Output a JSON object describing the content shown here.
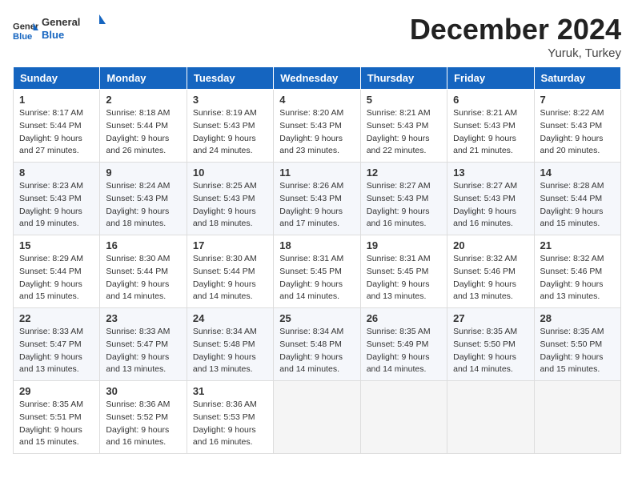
{
  "header": {
    "logo_line1": "General",
    "logo_line2": "Blue",
    "month_title": "December 2024",
    "location": "Yuruk, Turkey"
  },
  "weekdays": [
    "Sunday",
    "Monday",
    "Tuesday",
    "Wednesday",
    "Thursday",
    "Friday",
    "Saturday"
  ],
  "weeks": [
    [
      {
        "day": 1,
        "sunrise": "8:17 AM",
        "sunset": "5:44 PM",
        "daylight": "9 hours and 27 minutes."
      },
      {
        "day": 2,
        "sunrise": "8:18 AM",
        "sunset": "5:44 PM",
        "daylight": "9 hours and 26 minutes."
      },
      {
        "day": 3,
        "sunrise": "8:19 AM",
        "sunset": "5:43 PM",
        "daylight": "9 hours and 24 minutes."
      },
      {
        "day": 4,
        "sunrise": "8:20 AM",
        "sunset": "5:43 PM",
        "daylight": "9 hours and 23 minutes."
      },
      {
        "day": 5,
        "sunrise": "8:21 AM",
        "sunset": "5:43 PM",
        "daylight": "9 hours and 22 minutes."
      },
      {
        "day": 6,
        "sunrise": "8:21 AM",
        "sunset": "5:43 PM",
        "daylight": "9 hours and 21 minutes."
      },
      {
        "day": 7,
        "sunrise": "8:22 AM",
        "sunset": "5:43 PM",
        "daylight": "9 hours and 20 minutes."
      }
    ],
    [
      {
        "day": 8,
        "sunrise": "8:23 AM",
        "sunset": "5:43 PM",
        "daylight": "9 hours and 19 minutes."
      },
      {
        "day": 9,
        "sunrise": "8:24 AM",
        "sunset": "5:43 PM",
        "daylight": "9 hours and 18 minutes."
      },
      {
        "day": 10,
        "sunrise": "8:25 AM",
        "sunset": "5:43 PM",
        "daylight": "9 hours and 18 minutes."
      },
      {
        "day": 11,
        "sunrise": "8:26 AM",
        "sunset": "5:43 PM",
        "daylight": "9 hours and 17 minutes."
      },
      {
        "day": 12,
        "sunrise": "8:27 AM",
        "sunset": "5:43 PM",
        "daylight": "9 hours and 16 minutes."
      },
      {
        "day": 13,
        "sunrise": "8:27 AM",
        "sunset": "5:43 PM",
        "daylight": "9 hours and 16 minutes."
      },
      {
        "day": 14,
        "sunrise": "8:28 AM",
        "sunset": "5:44 PM",
        "daylight": "9 hours and 15 minutes."
      }
    ],
    [
      {
        "day": 15,
        "sunrise": "8:29 AM",
        "sunset": "5:44 PM",
        "daylight": "9 hours and 15 minutes."
      },
      {
        "day": 16,
        "sunrise": "8:30 AM",
        "sunset": "5:44 PM",
        "daylight": "9 hours and 14 minutes."
      },
      {
        "day": 17,
        "sunrise": "8:30 AM",
        "sunset": "5:44 PM",
        "daylight": "9 hours and 14 minutes."
      },
      {
        "day": 18,
        "sunrise": "8:31 AM",
        "sunset": "5:45 PM",
        "daylight": "9 hours and 14 minutes."
      },
      {
        "day": 19,
        "sunrise": "8:31 AM",
        "sunset": "5:45 PM",
        "daylight": "9 hours and 13 minutes."
      },
      {
        "day": 20,
        "sunrise": "8:32 AM",
        "sunset": "5:46 PM",
        "daylight": "9 hours and 13 minutes."
      },
      {
        "day": 21,
        "sunrise": "8:32 AM",
        "sunset": "5:46 PM",
        "daylight": "9 hours and 13 minutes."
      }
    ],
    [
      {
        "day": 22,
        "sunrise": "8:33 AM",
        "sunset": "5:47 PM",
        "daylight": "9 hours and 13 minutes."
      },
      {
        "day": 23,
        "sunrise": "8:33 AM",
        "sunset": "5:47 PM",
        "daylight": "9 hours and 13 minutes."
      },
      {
        "day": 24,
        "sunrise": "8:34 AM",
        "sunset": "5:48 PM",
        "daylight": "9 hours and 13 minutes."
      },
      {
        "day": 25,
        "sunrise": "8:34 AM",
        "sunset": "5:48 PM",
        "daylight": "9 hours and 14 minutes."
      },
      {
        "day": 26,
        "sunrise": "8:35 AM",
        "sunset": "5:49 PM",
        "daylight": "9 hours and 14 minutes."
      },
      {
        "day": 27,
        "sunrise": "8:35 AM",
        "sunset": "5:50 PM",
        "daylight": "9 hours and 14 minutes."
      },
      {
        "day": 28,
        "sunrise": "8:35 AM",
        "sunset": "5:50 PM",
        "daylight": "9 hours and 15 minutes."
      }
    ],
    [
      {
        "day": 29,
        "sunrise": "8:35 AM",
        "sunset": "5:51 PM",
        "daylight": "9 hours and 15 minutes."
      },
      {
        "day": 30,
        "sunrise": "8:36 AM",
        "sunset": "5:52 PM",
        "daylight": "9 hours and 16 minutes."
      },
      {
        "day": 31,
        "sunrise": "8:36 AM",
        "sunset": "5:53 PM",
        "daylight": "9 hours and 16 minutes."
      },
      null,
      null,
      null,
      null
    ]
  ],
  "labels": {
    "sunrise": "Sunrise:",
    "sunset": "Sunset:",
    "daylight": "Daylight:"
  }
}
